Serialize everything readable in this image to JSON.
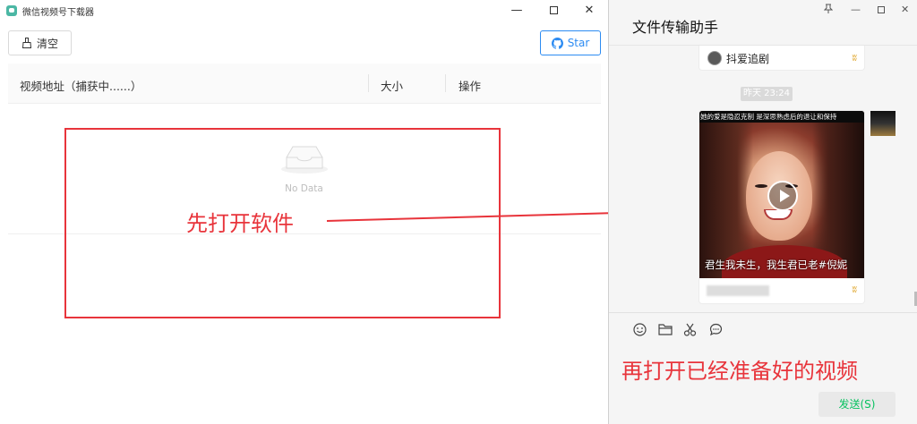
{
  "left_app": {
    "title": "微信视频号下载器",
    "window_controls": {
      "minimize": "—",
      "close": "✕"
    },
    "toolbar": {
      "clear_label": "清空",
      "star_label": "Star"
    },
    "table": {
      "columns": [
        "视频地址（捕获中......）",
        "大小",
        "操作"
      ],
      "empty_text": "No Data"
    }
  },
  "annotations": {
    "step1": "先打开软件",
    "step2": "再打开已经准备好的视频",
    "color": "#e8343b"
  },
  "chat": {
    "title": "文件传输助手",
    "controls": {
      "pin": "📌",
      "minimize": "—",
      "maximize": "☐",
      "close": "✕"
    },
    "forward_card": {
      "name": "抖爱追剧"
    },
    "timestamp": "昨天 23:24",
    "video_card": {
      "top_caption": "她的爱是隐忍克制 是深思熟虑后的退让和保持",
      "subtitle": "君生我未生，我生君已老#倪妮"
    },
    "send_label": "发送(S)",
    "accent": "#07c160"
  },
  "icons": [
    "app-logo-icon",
    "broom-icon",
    "github-icon",
    "inbox-empty-icon",
    "pin-icon",
    "emoji-icon",
    "folder-icon",
    "scissors-icon",
    "chat-bubble-icon",
    "play-icon",
    "channels-logo-icon"
  ]
}
